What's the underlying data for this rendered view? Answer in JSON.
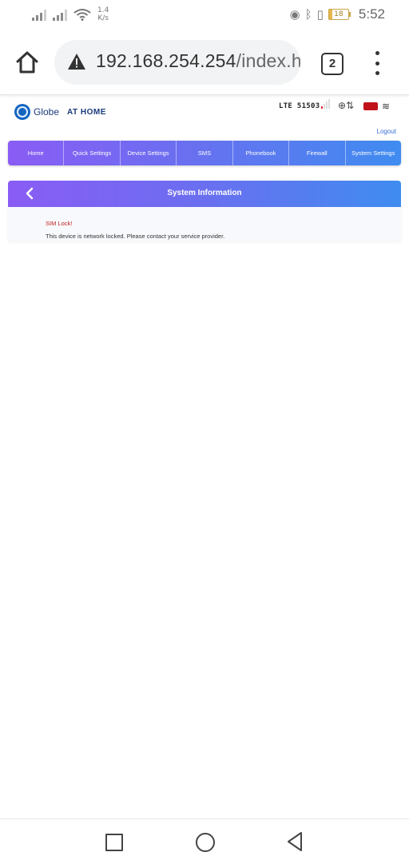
{
  "status_bar": {
    "speed_value": "1.4",
    "speed_unit": "K/s",
    "battery_level": "18",
    "time": "5:52",
    "colors": {
      "battery": "#e6b64c"
    }
  },
  "browser": {
    "url_host": "192.168.254.254",
    "url_path": "/index.h",
    "tab_count": "2",
    "icons": [
      "home-icon",
      "warning-icon",
      "tab-switcher-icon",
      "overflow-menu-icon"
    ]
  },
  "router": {
    "logo_text_1": "Globe",
    "logo_text_2": "AT HOME",
    "network_status": "LTE  51503",
    "logout_label": "Logout",
    "nav": [
      {
        "label": "Home"
      },
      {
        "label": "Quick Settings"
      },
      {
        "label": "Device Settings"
      },
      {
        "label": "SMS"
      },
      {
        "label": "Phonebook"
      },
      {
        "label": "Firewall"
      },
      {
        "label": "System Settings"
      }
    ],
    "section_title": "System Information",
    "sim_lock_title": "SIM Lock!",
    "sim_lock_message": "This device is network locked. Please contact your service provider.",
    "colors": {
      "nav_gradient_start": "#8a5cf5",
      "nav_gradient_end": "#3f8cf0",
      "alert_text": "#c02020",
      "sim_icon": "#c0101a"
    }
  },
  "system_nav": {
    "icons": [
      "recent-apps-icon",
      "home-circle-icon",
      "back-icon"
    ]
  }
}
